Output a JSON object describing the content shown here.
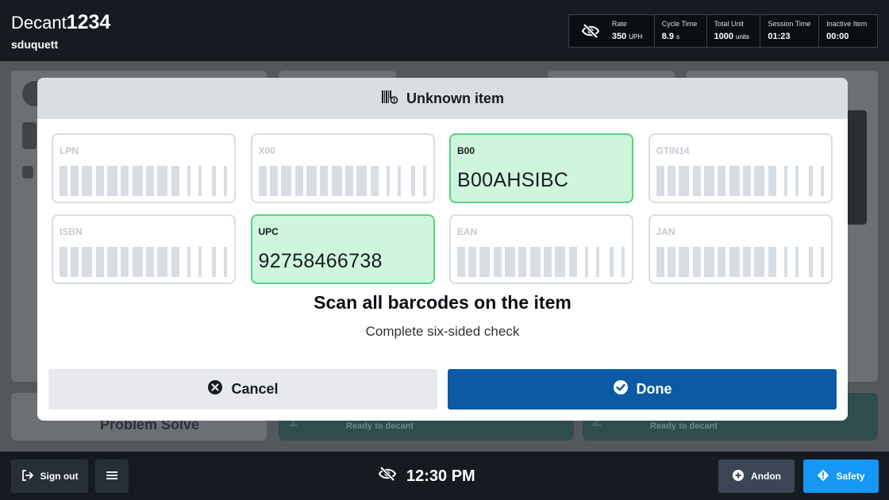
{
  "header": {
    "app_name": "Decant",
    "station_number": "1234",
    "username": "sduquett",
    "stats": {
      "rate": {
        "label": "Rate",
        "value": "350",
        "unit": "UPH"
      },
      "cycle_time": {
        "label": "Cycle Time",
        "value": "8.9",
        "unit": "s"
      },
      "total_unit": {
        "label": "Total Unit",
        "value": "1000",
        "unit": "units"
      },
      "session_time": {
        "label": "Session Time",
        "value": "01:23"
      },
      "inactive_item": {
        "label": "Inactive Item",
        "value": "00:00"
      }
    }
  },
  "background": {
    "problem_solve": "Problem Solve",
    "ready_1": "Ready to decant",
    "ready_2": "Ready to decant",
    "step_1": "1",
    "step_2": "2"
  },
  "modal": {
    "title": "Unknown item",
    "tiles": [
      {
        "label": "LPN",
        "value": "",
        "active": false
      },
      {
        "label": "X00",
        "value": "",
        "active": false
      },
      {
        "label": "B00",
        "value": "B00AHSIBC",
        "active": true
      },
      {
        "label": "GTIN14",
        "value": "",
        "active": false
      },
      {
        "label": "ISBN",
        "value": "",
        "active": false
      },
      {
        "label": "UPC",
        "value": "92758466738",
        "active": true
      },
      {
        "label": "EAN",
        "value": "",
        "active": false
      },
      {
        "label": "JAN",
        "value": "",
        "active": false
      }
    ],
    "prompt": "Scan all barcodes on the item",
    "subprompt": "Complete six-sided check",
    "cancel_label": "Cancel",
    "done_label": "Done"
  },
  "footer": {
    "sign_out_label": "Sign out",
    "time": "12:30 PM",
    "andon_label": "Andon",
    "safety_label": "Safety"
  },
  "colors": {
    "header_bg": "#161b22",
    "success_fill": "#d0f5dd",
    "success_border": "#54d483",
    "primary": "#0b5aa6",
    "safety": "#1497f5"
  },
  "icons": {
    "stats": "eye-slash-icon",
    "modal_title": "barcode-icon",
    "cancel": "x-circle-icon",
    "done": "check-circle-icon",
    "sign_out": "sign-out-icon",
    "menu": "hamburger-menu-icon",
    "clock": "eye-slash-icon",
    "andon": "plus-circle-icon",
    "safety": "diamond-exclamation-icon"
  }
}
